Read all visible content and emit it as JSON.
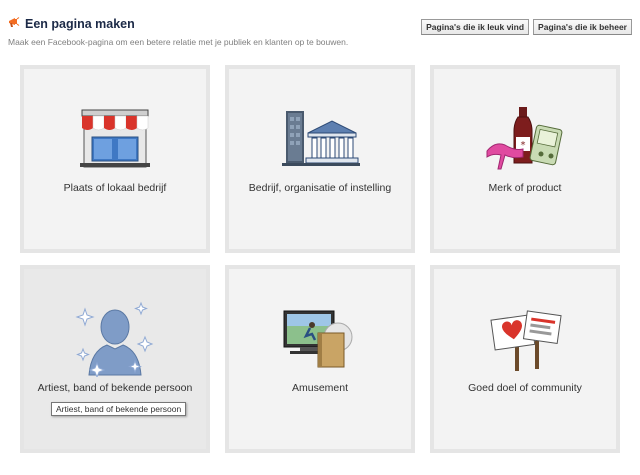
{
  "header": {
    "title": "Een pagina maken",
    "subtitle": "Maak een Facebook-pagina om een betere relatie met je publiek en klanten op te bouwen.",
    "buttons": [
      "Pagina's die ik leuk vind",
      "Pagina's die ik beheer"
    ]
  },
  "categories": [
    {
      "label": "Plaats of lokaal bedrijf",
      "icon": "storefront-icon"
    },
    {
      "label": "Bedrijf, organisatie of instelling",
      "icon": "office-building-icon"
    },
    {
      "label": "Merk of product",
      "icon": "products-icon"
    },
    {
      "label": "Artiest, band of bekende persoon",
      "icon": "celebrity-silhouette-icon",
      "tooltip": "Artiest, band of bekende persoon"
    },
    {
      "label": "Amusement",
      "icon": "entertainment-icon"
    },
    {
      "label": "Goed doel of community",
      "icon": "protest-signs-icon"
    }
  ],
  "colors": {
    "title": "#1c2a47",
    "tile_border": "#e5e5e5",
    "tile_bg": "#f3f3f3",
    "header_icon": "#f36c21"
  }
}
